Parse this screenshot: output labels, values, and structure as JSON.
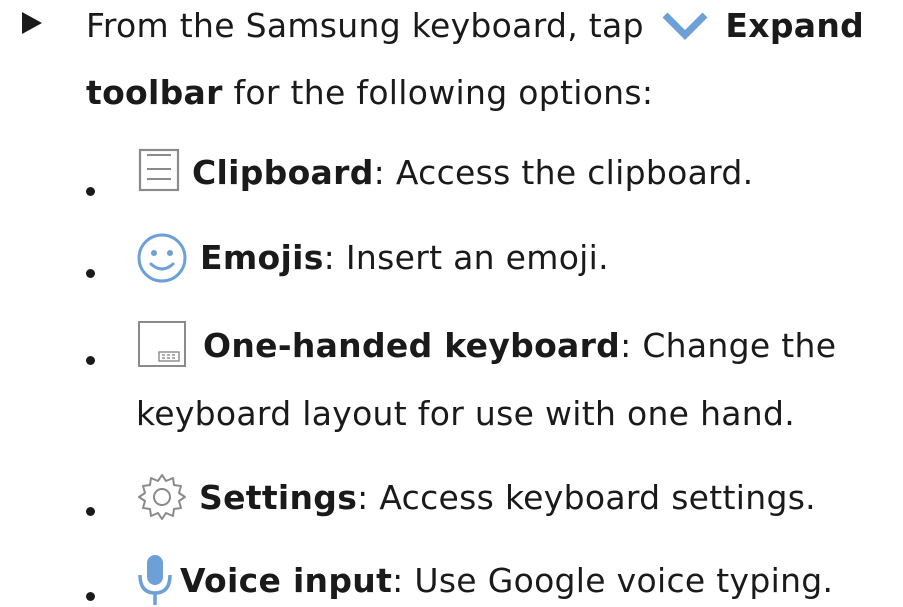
{
  "step": {
    "line1_prefix": "From the Samsung keyboard, tap",
    "line1_bold": "Expand",
    "line2_bold": "toolbar",
    "line2_rest": " for the following options:",
    "expand_icon": "chevron-down-icon"
  },
  "options": [
    {
      "icon": "clipboard-icon",
      "name": "Clipboard",
      "desc": ": Access the clipboard."
    },
    {
      "icon": "emoji-icon",
      "name": "Emojis",
      "desc": ": Insert an emoji."
    },
    {
      "icon": "one-handed-keyboard-icon",
      "name": "One-handed keyboard",
      "desc": ": Change the",
      "desc_cont": "keyboard layout for use with one hand."
    },
    {
      "icon": "gear-icon",
      "name": "Settings",
      "desc": ": Access keyboard settings."
    },
    {
      "icon": "microphone-icon",
      "name": "Voice input",
      "desc": ": Use Google voice typing."
    }
  ],
  "colors": {
    "text": "#1a1a1a",
    "icon_gray": "#8a8a8a",
    "accent_blue": "#6ea0d8"
  }
}
